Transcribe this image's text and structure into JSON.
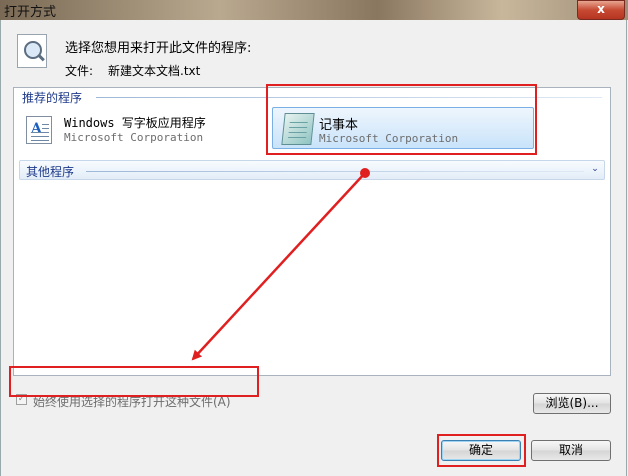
{
  "window": {
    "title": "打开方式",
    "close_glyph": "x"
  },
  "header": {
    "prompt": "选择您想用来打开此文件的程序:",
    "file_label": "文件:",
    "file_name": "新建文本文档.txt"
  },
  "groups": {
    "recommended_label": "推荐的程序",
    "other_label": "其他程序"
  },
  "programs": [
    {
      "name": "Windows 写字板应用程序",
      "vendor": "Microsoft Corporation",
      "icon": "wordpad-icon",
      "selected": false
    },
    {
      "name": "记事本",
      "vendor": "Microsoft Corporation",
      "icon": "notepad-icon",
      "selected": true
    }
  ],
  "options": {
    "always_use_label": "始终使用选择的程序打开这种文件(A)",
    "always_use_checked": true
  },
  "buttons": {
    "browse": "浏览(B)...",
    "ok": "确定",
    "cancel": "取消"
  },
  "annotation_color": "#e02020"
}
